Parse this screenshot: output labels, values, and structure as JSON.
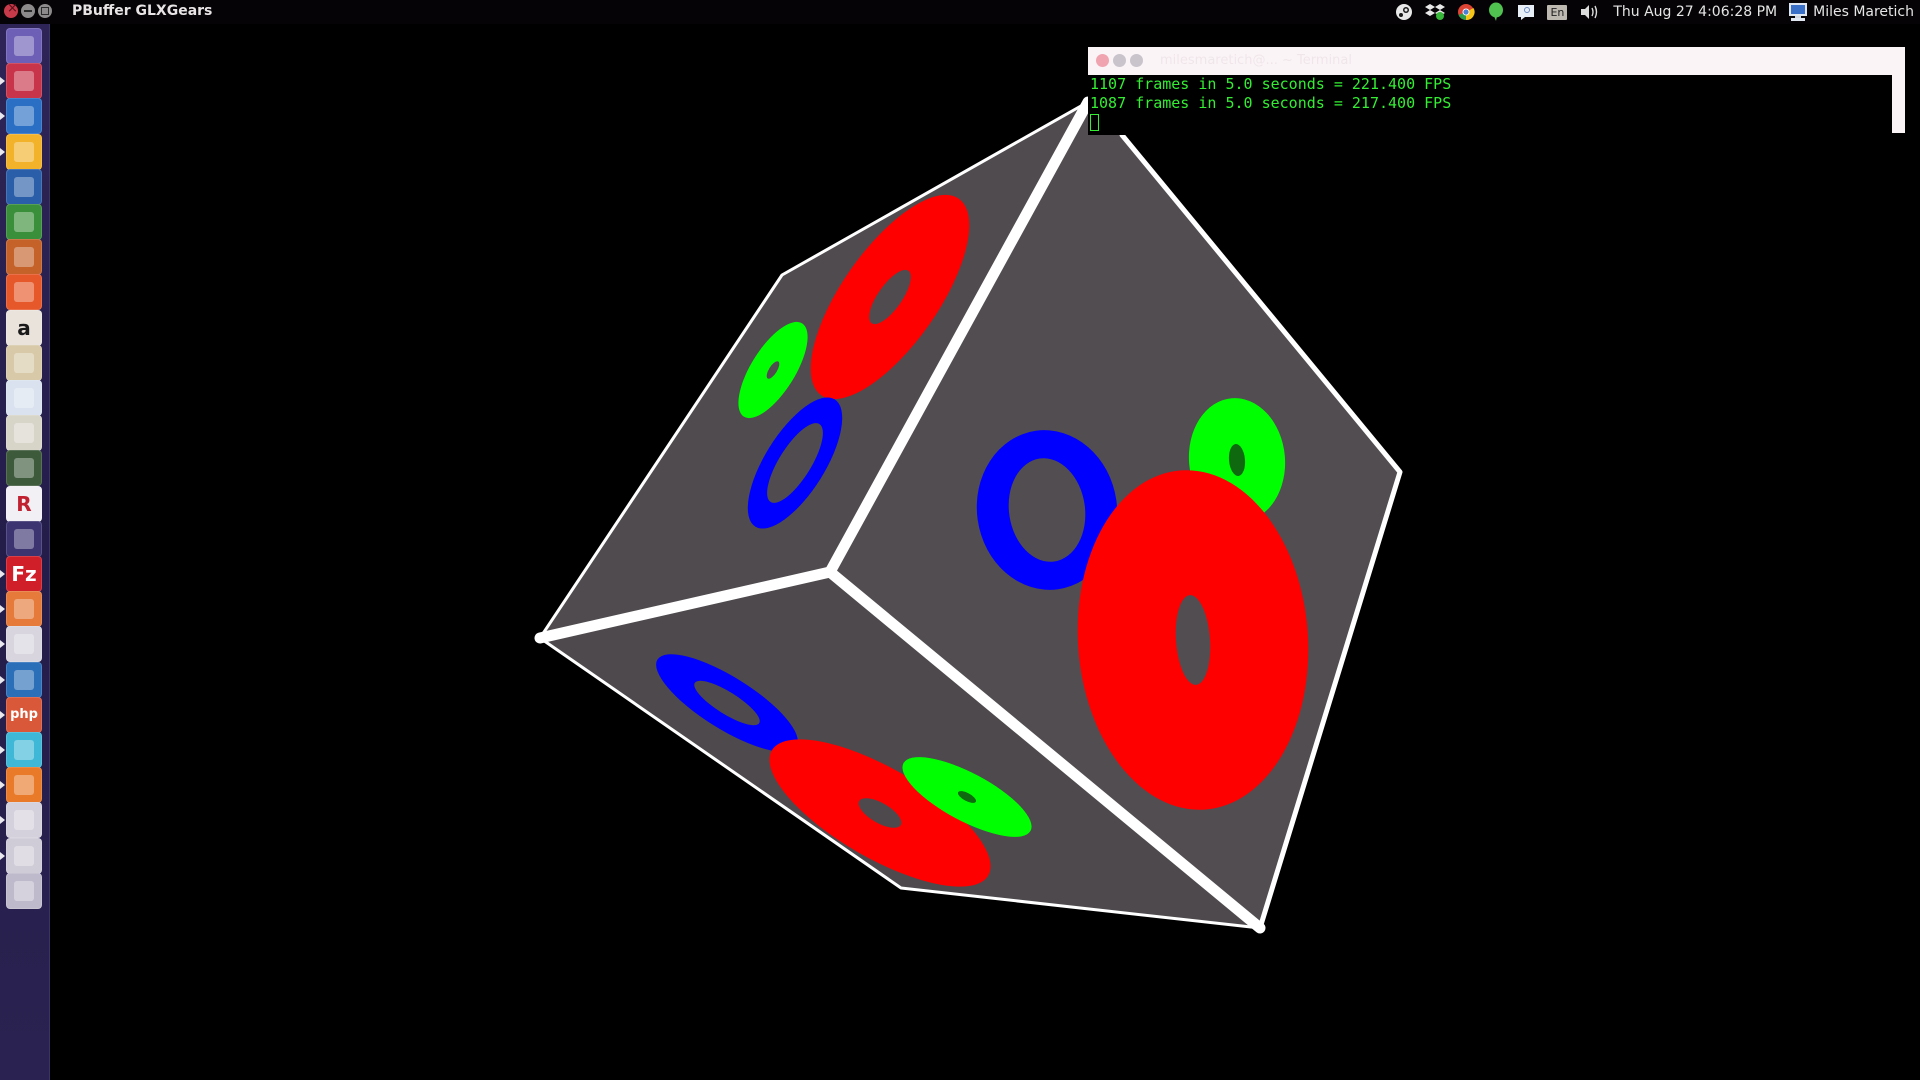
{
  "window": {
    "app_title": "PBuffer GLXGears"
  },
  "panel": {
    "indicators": [
      {
        "name": "steam-icon"
      },
      {
        "name": "dropbox-icon"
      },
      {
        "name": "chrome-icon"
      },
      {
        "name": "hangouts-icon"
      },
      {
        "name": "messaging-icon"
      }
    ],
    "language": "En",
    "sound_icon": "volume-icon",
    "clock": "Thu Aug 27  4:06:28 PM",
    "user_icon": "computer-icon",
    "user_name": "Miles Maretich"
  },
  "launcher": {
    "items": [
      {
        "name": "dash-home",
        "label": "",
        "bg": "#6d5fb5",
        "running": false
      },
      {
        "name": "file-cabinet",
        "label": "",
        "bg": "#c8344a",
        "running": true
      },
      {
        "name": "thunderbird",
        "label": "",
        "bg": "#2a6fc4",
        "running": true
      },
      {
        "name": "chrome",
        "label": "",
        "bg": "#f2b32a",
        "running": true
      },
      {
        "name": "libreoffice-writer",
        "label": "",
        "bg": "#2a5ea8",
        "running": false
      },
      {
        "name": "libreoffice-calc",
        "label": "",
        "bg": "#3a8f3a",
        "running": false
      },
      {
        "name": "libreoffice-impress",
        "label": "",
        "bg": "#c4622a",
        "running": false
      },
      {
        "name": "software-center",
        "label": "",
        "bg": "#e6582a",
        "running": false
      },
      {
        "name": "amazon",
        "label": "a",
        "bg": "#e9e3dc",
        "running": false
      },
      {
        "name": "files",
        "label": "",
        "bg": "#d8c9a8",
        "running": false
      },
      {
        "name": "image-viewer",
        "label": "",
        "bg": "#d9e2ee",
        "running": false
      },
      {
        "name": "bleachbit",
        "label": "",
        "bg": "#d7d4c8",
        "running": false
      },
      {
        "name": "system-monitor",
        "label": "",
        "bg": "#3d5a3a",
        "running": false
      },
      {
        "name": "rstudio",
        "label": "R",
        "bg": "#f2f0f4",
        "running": false
      },
      {
        "name": "app-circle",
        "label": "",
        "bg": "#3b3470",
        "running": false
      },
      {
        "name": "filezilla",
        "label": "Fz",
        "bg": "#d11f2a",
        "running": true
      },
      {
        "name": "text-editor",
        "label": "",
        "bg": "#e57a3a",
        "running": true
      },
      {
        "name": "terminal",
        "label": "",
        "bg": "#d8d5df",
        "running": true
      },
      {
        "name": "steam",
        "label": "",
        "bg": "#2b6fb8",
        "running": true
      },
      {
        "name": "php-app",
        "label": "php",
        "bg": "#d9583a",
        "running": true
      },
      {
        "name": "mesh-app",
        "label": "",
        "bg": "#3fb8d8",
        "running": true
      },
      {
        "name": "color-app",
        "label": "",
        "bg": "#e87a2a",
        "running": true
      },
      {
        "name": "obs-studio",
        "label": "",
        "bg": "#d4d0dc",
        "running": true
      },
      {
        "name": "workspace-switcher",
        "label": "",
        "bg": "#cfcbd7",
        "running": true
      },
      {
        "name": "trash",
        "label": "",
        "bg": "#bfbacb",
        "running": false
      }
    ]
  },
  "scene": {
    "description": "Rotating cube with glxgears rendered on its faces",
    "face_color": "#4f4b4e",
    "edge_color": "#ffffff",
    "gear_colors": {
      "red": "#ff0000",
      "green": "#00ff00",
      "blue": "#0000ff"
    }
  },
  "terminal": {
    "title": "milesmaretich@... ~ Terminal",
    "lines": [
      "1107 frames in 5.0 seconds = 221.400 FPS",
      "1087 frames in 5.0 seconds = 217.400 FPS"
    ]
  }
}
